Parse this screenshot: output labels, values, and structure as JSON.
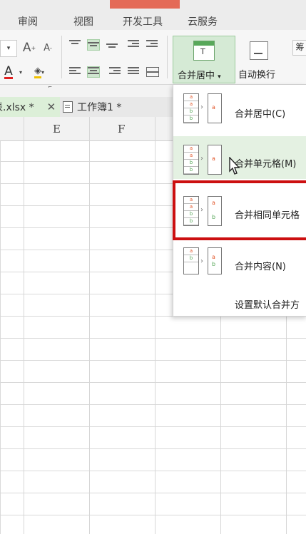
{
  "menu_tabs": [
    "审阅",
    "视图",
    "开发工具",
    "云服务"
  ],
  "ribbon": {
    "merge_button_label": "合并居中",
    "merge_button_icon_text": "T",
    "wrap_button_label": "自动换行",
    "font_grow_label": "A",
    "font_shrink_label": "A",
    "font_color_label": "A",
    "more_label": "筹"
  },
  "file_tabs": [
    {
      "label": "表.xlsx *",
      "active": true
    },
    {
      "label": "工作簿1 *",
      "active": false
    }
  ],
  "columns": [
    "E",
    "F"
  ],
  "dropdown": {
    "items": [
      {
        "label": "合并居中(C)"
      },
      {
        "label": "合并单元格(M)"
      },
      {
        "label": "合并相同单元格"
      },
      {
        "label": "合并内容(N)"
      }
    ],
    "default_option": "设置默认合并方"
  },
  "colors": {
    "accent_green": "#58a85a",
    "highlight_red": "#cc0f10",
    "cursor_yellow": "#fff500"
  }
}
